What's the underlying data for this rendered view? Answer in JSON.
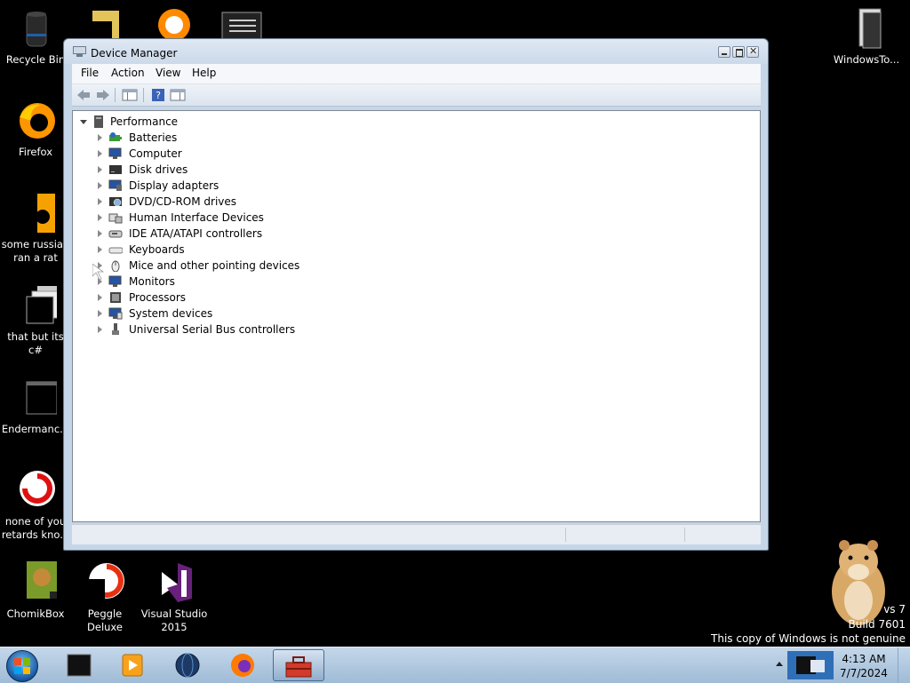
{
  "desktop": {
    "icons": [
      {
        "label": "Recycle Bin"
      },
      {
        "label": "Firefox"
      },
      {
        "label": "some russian ran a rat"
      },
      {
        "label": "that but its c#"
      },
      {
        "label": "Endermanc..."
      },
      {
        "label": "none of you retards kno..."
      },
      {
        "label": "ChomikBox"
      },
      {
        "label": "Peggle Deluxe"
      },
      {
        "label": "Visual Studio 2015"
      },
      {
        "label": "WindowsTo..."
      }
    ]
  },
  "window": {
    "title": "Device Manager",
    "menu": [
      "File",
      "Action",
      "View",
      "Help"
    ],
    "tree": {
      "root": "Performance",
      "children": [
        "Batteries",
        "Computer",
        "Disk drives",
        "Display adapters",
        "DVD/CD-ROM drives",
        "Human Interface Devices",
        "IDE ATA/ATAPI controllers",
        "Keyboards",
        "Mice and other pointing devices",
        "Monitors",
        "Processors",
        "System devices",
        "Universal Serial Bus controllers"
      ]
    }
  },
  "watermark": {
    "line1": "vs 7",
    "line2": "Build 7601",
    "line3": "This copy of Windows is not genuine"
  },
  "taskbar": {
    "time": "4:13 AM",
    "date": "7/7/2024"
  },
  "colors": {
    "desktop": "#000000",
    "taskbar": "#b3cbe3",
    "window_frame": "#c5d6e8"
  }
}
